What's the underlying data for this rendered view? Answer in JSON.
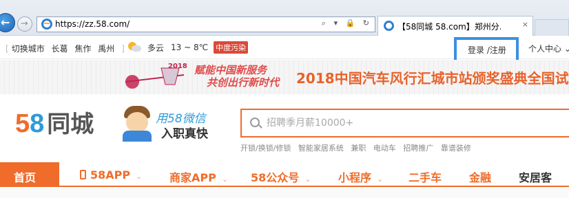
{
  "browser": {
    "url": "https://zz.58.com/",
    "tab_title": "【58同城 58.com】郑州分...",
    "tab_close": "×",
    "addr_icons": "⌕ ▾ 🔒 ↻"
  },
  "topbar": {
    "city_prefix": "[",
    "switch_city": "切换城市",
    "nearby": [
      "长葛",
      "焦作",
      "禹州"
    ],
    "city_suffix": "]",
    "weather_condition": "多云",
    "temperature": "13 ~ 8℃",
    "air_quality": "中度污染",
    "login": "登录 /注册",
    "user_center": "个人中心",
    "user_center_chevron": "⌄"
  },
  "banner": {
    "year": "2018",
    "slogan_line1": "赋能中国新服务",
    "slogan_line2": "共创出行新时代",
    "title": "2018中国汽车风行汇城市站颁奖盛典全国试"
  },
  "brand": {
    "logo_5": "5",
    "logo_8": "8",
    "logo_cn": "同城",
    "promo_line1": "用58微信",
    "promo_line2": "入职真快"
  },
  "search": {
    "placeholder": "招聘季月薪10000+",
    "hotwords": [
      "开锁/换锁/修锁",
      "智能家居系统",
      "兼职",
      "电动车",
      "招聘推广",
      "靠谱装修"
    ]
  },
  "nav": {
    "home": "首页",
    "items": [
      {
        "label": "58APP",
        "has_menu": true
      },
      {
        "label": "商家APP",
        "has_menu": true
      },
      {
        "label": "58公众号",
        "has_menu": true
      },
      {
        "label": "小程序",
        "has_menu": true
      },
      {
        "label": "二手车",
        "has_menu": false
      },
      {
        "label": "金融",
        "has_menu": false
      },
      {
        "label": "安居客",
        "has_menu": false
      }
    ],
    "chevron": "⌄"
  },
  "colors": {
    "brand_orange": "#f06c2a",
    "brand_blue": "#2d9bda",
    "highlight_box": "#3a90e0"
  }
}
